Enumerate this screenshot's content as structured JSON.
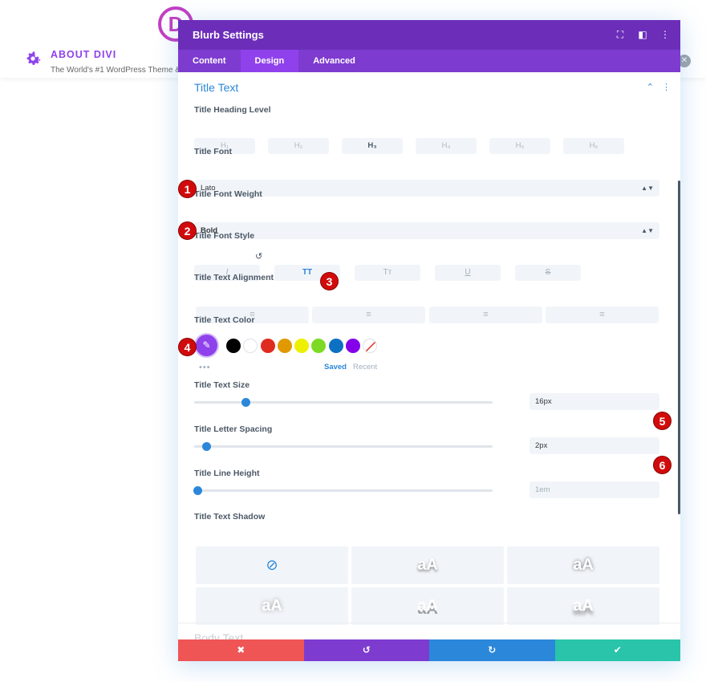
{
  "background": {
    "logo_letter": "D",
    "title": "ABOUT DIVI",
    "subtitle": "The World's #1 WordPress Theme &",
    "icons": {
      "gear": "gear-icon",
      "close": "close-icon"
    }
  },
  "modal": {
    "title": "Blurb Settings",
    "header_icons": [
      "expand-icon",
      "sidebar-icon",
      "more-icon"
    ],
    "tabs": [
      {
        "label": "Content"
      },
      {
        "label": "Design",
        "active": true
      },
      {
        "label": "Advanced"
      }
    ],
    "section_title": "Title Text",
    "next_section": "Body Text",
    "heading_level": {
      "label": "Title Heading Level",
      "options": [
        "H₁",
        "H₂",
        "H₃",
        "H₄",
        "H₅",
        "H₆"
      ],
      "selected": "H₃"
    },
    "font": {
      "label": "Title Font",
      "value": "Lato"
    },
    "font_weight": {
      "label": "Title Font Weight",
      "value": "Bold"
    },
    "font_style": {
      "label": "Title Font Style",
      "options": [
        "I",
        "TT",
        "Tт",
        "U",
        "S"
      ],
      "active": "TT"
    },
    "alignment": {
      "label": "Title Text Alignment",
      "options": [
        "left",
        "center",
        "right",
        "justify"
      ]
    },
    "text_color": {
      "label": "Title Text Color",
      "swatches": [
        "#000000",
        "#ffffff",
        "#e02b20",
        "#e09900",
        "#edf000",
        "#7cda24",
        "#0c71c3",
        "#8300e9"
      ],
      "picker_color": "#8f42ec",
      "more": "•••",
      "saved_label": "Saved",
      "recent_label": "Recent"
    },
    "text_size": {
      "label": "Title Text Size",
      "value": "16px",
      "slider_fraction": 0.16
    },
    "letter_spacing": {
      "label": "Title Letter Spacing",
      "value": "2px",
      "slider_fraction": 0.03
    },
    "line_height": {
      "label": "Title Line Height",
      "placeholder": "1em",
      "slider_fraction": 0.0
    },
    "text_shadow": {
      "label": "Title Text Shadow",
      "sample": "aA"
    },
    "badges": [
      "1",
      "2",
      "3",
      "4",
      "5",
      "6"
    ],
    "footer": {
      "cancel": "✖",
      "undo": "↺",
      "redo": "↻",
      "save": "✔",
      "colors": [
        "#ef5555",
        "#7e3bd0",
        "#2b87da",
        "#29c4a9"
      ]
    }
  }
}
